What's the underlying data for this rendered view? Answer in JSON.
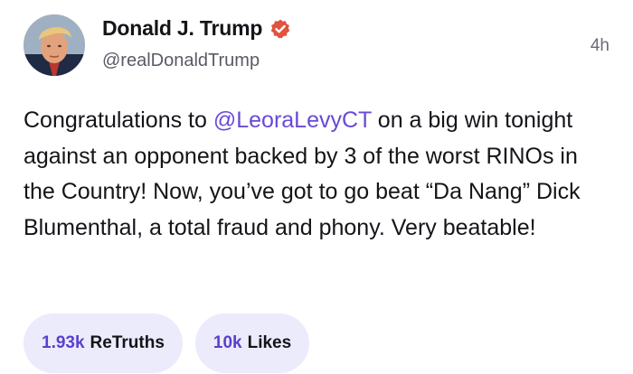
{
  "author": {
    "display_name": "Donald J. Trump",
    "handle": "@realDonaldTrump",
    "verified": true
  },
  "post": {
    "timestamp": "4h",
    "text_parts": {
      "before_mention": "Congratulations to ",
      "mention": "@LeoraLevyCT",
      "after_mention": " on a big win tonight against an opponent backed by 3 of the worst RINOs in the Country! Now, you’ve got to go beat “Da Nang” Dick Blumenthal, a total fraud and phony. Very beatable!"
    }
  },
  "stats": {
    "retruths": {
      "count": "1.93k",
      "label": "ReTruths"
    },
    "likes": {
      "count": "10k",
      "label": "Likes"
    }
  },
  "colors": {
    "accent": "#5a3fd0",
    "mention": "#6a49d6",
    "verified_badge": "#e0533e",
    "pill_background": "#ecebfb"
  },
  "icons": {
    "verified": "verified-badge-icon"
  }
}
